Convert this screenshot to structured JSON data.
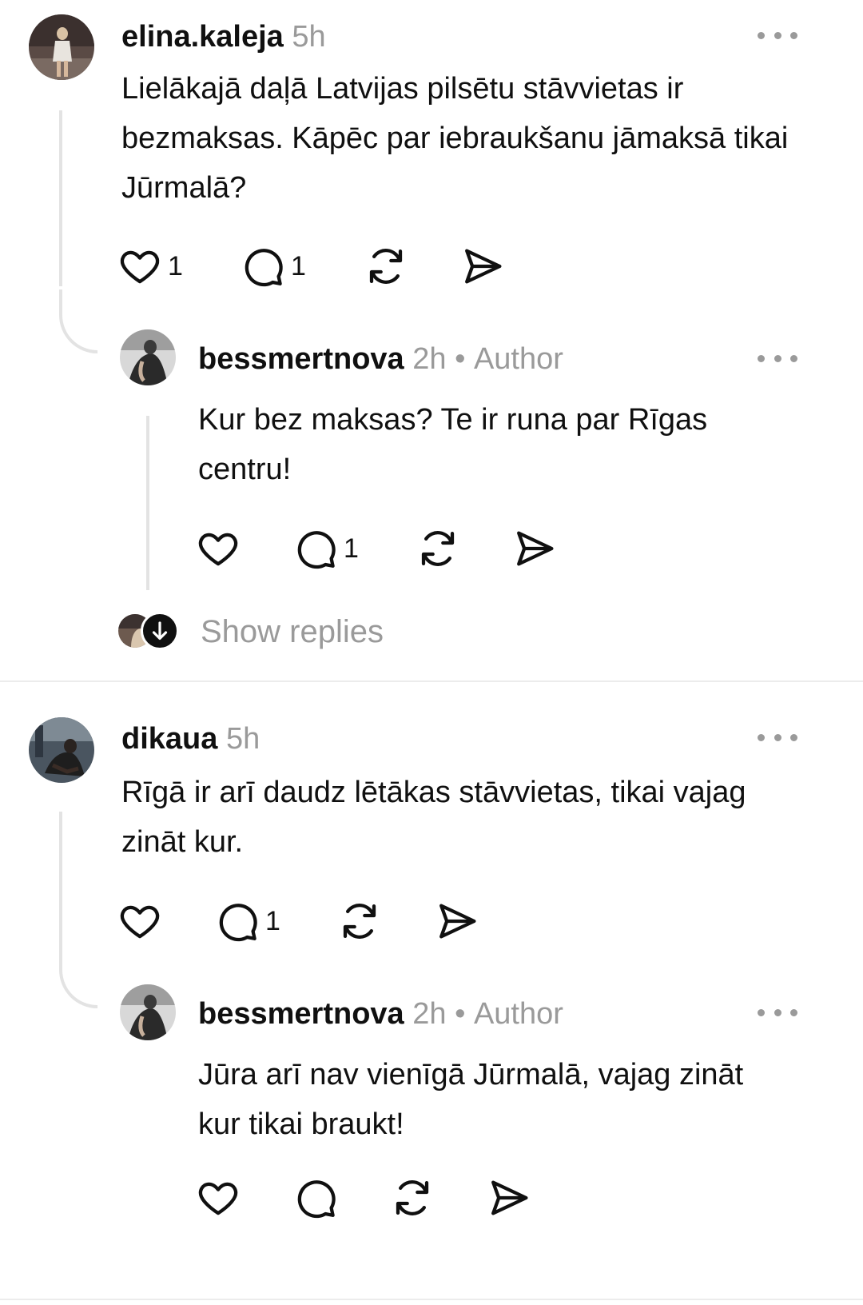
{
  "comments": [
    {
      "username": "elina.kaleja",
      "time": "5h",
      "text": "Lielākajā daļā Latvijas pilsētu stāvvietas ir bezmaksas. Kāpēc par iebraukšanu jāmaksā tikai Jūrmalā?",
      "likes": "1",
      "replies": "1",
      "reply": {
        "username": "bessmertnova",
        "time": "2h",
        "badge": "Author",
        "text": "Kur bez maksas? Te ir runa par Rīgas centru!",
        "replies": "1"
      },
      "show_replies": "Show replies"
    },
    {
      "username": "dikaua",
      "time": "5h",
      "text": "Rīgā ir arī daudz lētākas stāvvietas, tikai vajag zināt kur.",
      "replies": "1",
      "reply": {
        "username": "bessmertnova",
        "time": "2h",
        "badge": "Author",
        "text": "Jūra arī nav vienīgā Jūrmalā, vajag zināt kur tikai braukt!"
      }
    }
  ],
  "icons": [
    "heart-icon",
    "comment-icon",
    "repost-icon",
    "share-icon",
    "more-icon",
    "arrow-down-icon"
  ],
  "colors": {
    "text": "#101010",
    "muted": "#9a9a9a",
    "thread_line": "#e3e3e3",
    "divider": "#ececec"
  }
}
